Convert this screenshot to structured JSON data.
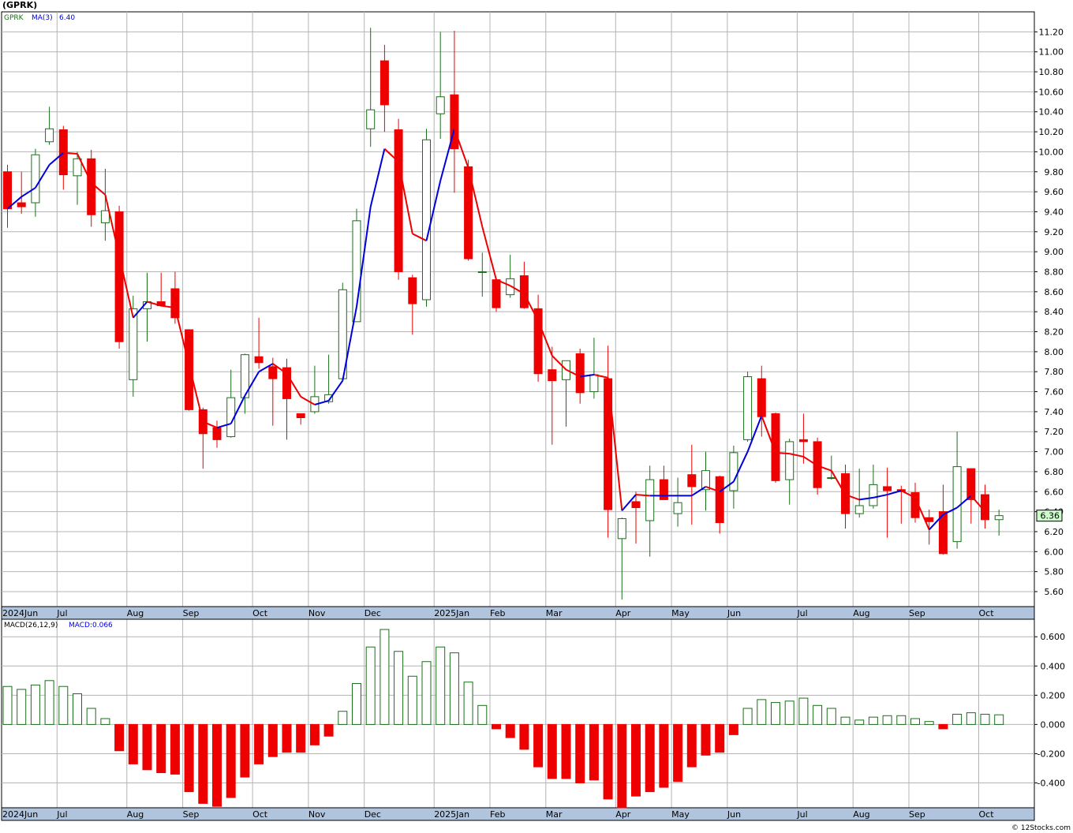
{
  "title": "(GPRK)",
  "copyright": "© 12Stocks.com",
  "colors": {
    "up": "#1a6e1a",
    "down": "#ee0000",
    "ma_up": "#0000dd",
    "ma_down": "#ee0000",
    "grid": "#b4b4b4",
    "axis_strip": "#b0c4de",
    "last_price_bg": "#ccffcc"
  },
  "chart_data": [
    {
      "type": "candlestick",
      "legend": {
        "ticker": "GPRK",
        "ma_label": "MA(3)",
        "ma_value": "6.40"
      },
      "y_ticks": [
        "5.60",
        "5.80",
        "6.00",
        "6.20",
        "6.40",
        "6.60",
        "6.80",
        "7.00",
        "7.20",
        "7.40",
        "7.60",
        "7.80",
        "8.00",
        "8.20",
        "8.40",
        "8.60",
        "8.80",
        "9.00",
        "9.20",
        "9.40",
        "9.60",
        "9.80",
        "10.00",
        "10.20",
        "10.40",
        "10.60",
        "10.80",
        "11.00",
        "11.20"
      ],
      "ylim": [
        5.45,
        11.4
      ],
      "last_price_label": "6.36",
      "x_labels": [
        {
          "label": "2024Jun",
          "i": 0
        },
        {
          "label": "Jul",
          "i": 4
        },
        {
          "label": "Aug",
          "i": 9
        },
        {
          "label": "Sep",
          "i": 13
        },
        {
          "label": "Oct",
          "i": 18
        },
        {
          "label": "Nov",
          "i": 22
        },
        {
          "label": "Dec",
          "i": 26
        },
        {
          "label": "2025Jan",
          "i": 31
        },
        {
          "label": "Feb",
          "i": 35
        },
        {
          "label": "Mar",
          "i": 39
        },
        {
          "label": "Apr",
          "i": 44
        },
        {
          "label": "May",
          "i": 48
        },
        {
          "label": "Jun",
          "i": 52
        },
        {
          "label": "Jul",
          "i": 57
        },
        {
          "label": "Aug",
          "i": 61
        },
        {
          "label": "Sep",
          "i": 65
        },
        {
          "label": "Oct",
          "i": 70
        }
      ],
      "candles": [
        {
          "o": 9.8,
          "h": 9.87,
          "l": 9.24,
          "c": 9.43
        },
        {
          "o": 9.49,
          "h": 9.8,
          "l": 9.38,
          "c": 9.45
        },
        {
          "o": 9.49,
          "h": 10.03,
          "l": 9.35,
          "c": 9.97
        },
        {
          "o": 10.1,
          "h": 10.45,
          "l": 10.07,
          "c": 10.23
        },
        {
          "o": 10.22,
          "h": 10.26,
          "l": 9.62,
          "c": 9.77
        },
        {
          "o": 9.76,
          "h": 10.0,
          "l": 9.47,
          "c": 9.93
        },
        {
          "o": 9.93,
          "h": 10.02,
          "l": 9.25,
          "c": 9.37
        },
        {
          "o": 9.29,
          "h": 9.83,
          "l": 9.11,
          "c": 9.41
        },
        {
          "o": 9.4,
          "h": 9.46,
          "l": 8.03,
          "c": 8.1
        },
        {
          "o": 7.72,
          "h": 8.56,
          "l": 7.55,
          "c": 8.43
        },
        {
          "o": 8.43,
          "h": 8.79,
          "l": 8.1,
          "c": 8.5
        },
        {
          "o": 8.5,
          "h": 8.79,
          "l": 8.45,
          "c": 8.46
        },
        {
          "o": 8.63,
          "h": 8.8,
          "l": 8.28,
          "c": 8.34
        },
        {
          "o": 8.22,
          "h": 8.22,
          "l": 7.41,
          "c": 7.42
        },
        {
          "o": 7.42,
          "h": 7.44,
          "l": 6.83,
          "c": 7.18
        },
        {
          "o": 7.24,
          "h": 7.31,
          "l": 7.04,
          "c": 7.12
        },
        {
          "o": 7.15,
          "h": 7.82,
          "l": 7.14,
          "c": 7.54
        },
        {
          "o": 7.54,
          "h": 7.98,
          "l": 7.38,
          "c": 7.97
        },
        {
          "o": 7.95,
          "h": 8.34,
          "l": 7.83,
          "c": 7.89
        },
        {
          "o": 7.85,
          "h": 7.94,
          "l": 7.26,
          "c": 7.73
        },
        {
          "o": 7.84,
          "h": 7.93,
          "l": 7.12,
          "c": 7.53
        },
        {
          "o": 7.38,
          "h": 7.38,
          "l": 7.27,
          "c": 7.34
        },
        {
          "o": 7.4,
          "h": 7.86,
          "l": 7.38,
          "c": 7.55
        },
        {
          "o": 7.5,
          "h": 7.97,
          "l": 7.48,
          "c": 7.57
        },
        {
          "o": 7.73,
          "h": 8.69,
          "l": 7.72,
          "c": 8.62
        },
        {
          "o": 8.3,
          "h": 9.43,
          "l": 8.3,
          "c": 9.31
        },
        {
          "o": 10.23,
          "h": 11.24,
          "l": 10.05,
          "c": 10.42
        },
        {
          "o": 10.91,
          "h": 11.07,
          "l": 10.2,
          "c": 10.47
        },
        {
          "o": 10.22,
          "h": 10.33,
          "l": 8.72,
          "c": 8.8
        },
        {
          "o": 8.74,
          "h": 8.77,
          "l": 8.17,
          "c": 8.48
        },
        {
          "o": 8.52,
          "h": 10.23,
          "l": 8.45,
          "c": 10.12
        },
        {
          "o": 10.38,
          "h": 11.2,
          "l": 10.13,
          "c": 10.55
        },
        {
          "o": 10.57,
          "h": 11.21,
          "l": 9.59,
          "c": 10.03
        },
        {
          "o": 9.85,
          "h": 9.92,
          "l": 8.91,
          "c": 8.93
        },
        {
          "o": 8.8,
          "h": 8.99,
          "l": 8.55,
          "c": 8.8
        },
        {
          "o": 8.72,
          "h": 8.72,
          "l": 8.4,
          "c": 8.44
        },
        {
          "o": 8.57,
          "h": 8.97,
          "l": 8.54,
          "c": 8.73
        },
        {
          "o": 8.76,
          "h": 8.9,
          "l": 8.43,
          "c": 8.44
        },
        {
          "o": 8.43,
          "h": 8.57,
          "l": 7.7,
          "c": 7.78
        },
        {
          "o": 7.82,
          "h": 8.05,
          "l": 7.07,
          "c": 7.71
        },
        {
          "o": 7.72,
          "h": 7.89,
          "l": 7.25,
          "c": 7.91
        },
        {
          "o": 7.98,
          "h": 8.03,
          "l": 7.48,
          "c": 7.59
        },
        {
          "o": 7.6,
          "h": 8.14,
          "l": 7.53,
          "c": 7.77
        },
        {
          "o": 7.73,
          "h": 8.06,
          "l": 6.14,
          "c": 6.42
        },
        {
          "o": 6.13,
          "h": 6.34,
          "l": 5.52,
          "c": 6.33
        },
        {
          "o": 6.5,
          "h": 6.6,
          "l": 6.08,
          "c": 6.44
        },
        {
          "o": 6.31,
          "h": 6.86,
          "l": 5.95,
          "c": 6.72
        },
        {
          "o": 6.72,
          "h": 6.86,
          "l": 6.53,
          "c": 6.52
        },
        {
          "o": 6.38,
          "h": 6.74,
          "l": 6.25,
          "c": 6.49
        },
        {
          "o": 6.77,
          "h": 7.07,
          "l": 6.27,
          "c": 6.65
        },
        {
          "o": 6.62,
          "h": 7.0,
          "l": 6.41,
          "c": 6.81
        },
        {
          "o": 6.75,
          "h": 6.76,
          "l": 6.18,
          "c": 6.29
        },
        {
          "o": 6.61,
          "h": 7.06,
          "l": 6.43,
          "c": 6.99
        },
        {
          "o": 7.12,
          "h": 7.8,
          "l": 7.1,
          "c": 7.75
        },
        {
          "o": 7.73,
          "h": 7.86,
          "l": 7.15,
          "c": 7.35
        },
        {
          "o": 7.38,
          "h": 7.39,
          "l": 6.69,
          "c": 6.71
        },
        {
          "o": 6.72,
          "h": 7.13,
          "l": 6.47,
          "c": 7.1
        },
        {
          "o": 7.12,
          "h": 7.38,
          "l": 6.88,
          "c": 7.1
        },
        {
          "o": 7.1,
          "h": 7.14,
          "l": 6.57,
          "c": 6.64
        },
        {
          "o": 6.74,
          "h": 6.96,
          "l": 6.72,
          "c": 6.74
        },
        {
          "o": 6.78,
          "h": 6.87,
          "l": 6.23,
          "c": 6.38
        },
        {
          "o": 6.38,
          "h": 6.83,
          "l": 6.34,
          "c": 6.46
        },
        {
          "o": 6.46,
          "h": 6.87,
          "l": 6.43,
          "c": 6.67
        },
        {
          "o": 6.65,
          "h": 6.84,
          "l": 6.14,
          "c": 6.61
        },
        {
          "o": 6.62,
          "h": 6.66,
          "l": 6.28,
          "c": 6.6
        },
        {
          "o": 6.59,
          "h": 6.69,
          "l": 6.29,
          "c": 6.34
        },
        {
          "o": 6.34,
          "h": 6.42,
          "l": 6.07,
          "c": 6.3
        },
        {
          "o": 6.4,
          "h": 6.67,
          "l": 5.97,
          "c": 5.98
        },
        {
          "o": 6.1,
          "h": 7.2,
          "l": 6.03,
          "c": 6.85
        },
        {
          "o": 6.83,
          "h": 6.8,
          "l": 6.28,
          "c": 6.52
        },
        {
          "o": 6.57,
          "h": 6.67,
          "l": 6.23,
          "c": 6.32
        },
        {
          "o": 6.32,
          "h": 6.42,
          "l": 6.16,
          "c": 6.36
        }
      ],
      "ma3": [
        9.43,
        9.55,
        9.64,
        9.87,
        9.99,
        9.98,
        9.69,
        9.57,
        8.96,
        8.34,
        8.5,
        8.46,
        8.44,
        7.87,
        7.3,
        7.24,
        7.28,
        7.56,
        7.8,
        7.88,
        7.78,
        7.55,
        7.47,
        7.51,
        7.71,
        8.45,
        9.45,
        10.03,
        9.9,
        9.18,
        9.11,
        9.71,
        10.23,
        9.84,
        9.25,
        8.72,
        8.66,
        8.58,
        8.31,
        7.96,
        7.82,
        7.75,
        7.77,
        7.74,
        6.41,
        6.57,
        6.56,
        6.56,
        6.56,
        6.56,
        6.65,
        6.6,
        6.7,
        7.0,
        7.36,
        6.99,
        6.98,
        6.95,
        6.86,
        6.81,
        6.57,
        6.52,
        6.54,
        6.57,
        6.61,
        6.54,
        6.22,
        6.37,
        6.44,
        6.56,
        6.4
      ]
    },
    {
      "type": "bar",
      "legend": {
        "label": "MACD(26,12,9)",
        "value_label": "MACD:0.066"
      },
      "y_ticks": [
        "-0.400",
        "-0.200",
        "0.000",
        "0.200",
        "0.400",
        "0.600"
      ],
      "ylim": [
        -0.57,
        0.72
      ],
      "values": [
        0.26,
        0.24,
        0.27,
        0.3,
        0.26,
        0.21,
        0.11,
        0.04,
        -0.18,
        -0.27,
        -0.31,
        -0.33,
        -0.34,
        -0.46,
        -0.54,
        -0.56,
        -0.5,
        -0.36,
        -0.27,
        -0.22,
        -0.19,
        -0.19,
        -0.14,
        -0.08,
        0.09,
        0.28,
        0.53,
        0.65,
        0.5,
        0.33,
        0.43,
        0.53,
        0.49,
        0.29,
        0.13,
        -0.03,
        -0.09,
        -0.17,
        -0.29,
        -0.37,
        -0.37,
        -0.4,
        -0.38,
        -0.51,
        -0.57,
        -0.49,
        -0.46,
        -0.43,
        -0.39,
        -0.29,
        -0.21,
        -0.19,
        -0.07,
        0.11,
        0.17,
        0.15,
        0.16,
        0.18,
        0.13,
        0.11,
        0.05,
        0.03,
        0.05,
        0.06,
        0.06,
        0.04,
        0.02,
        -0.03,
        0.07,
        0.08,
        0.07,
        0.066
      ]
    }
  ]
}
